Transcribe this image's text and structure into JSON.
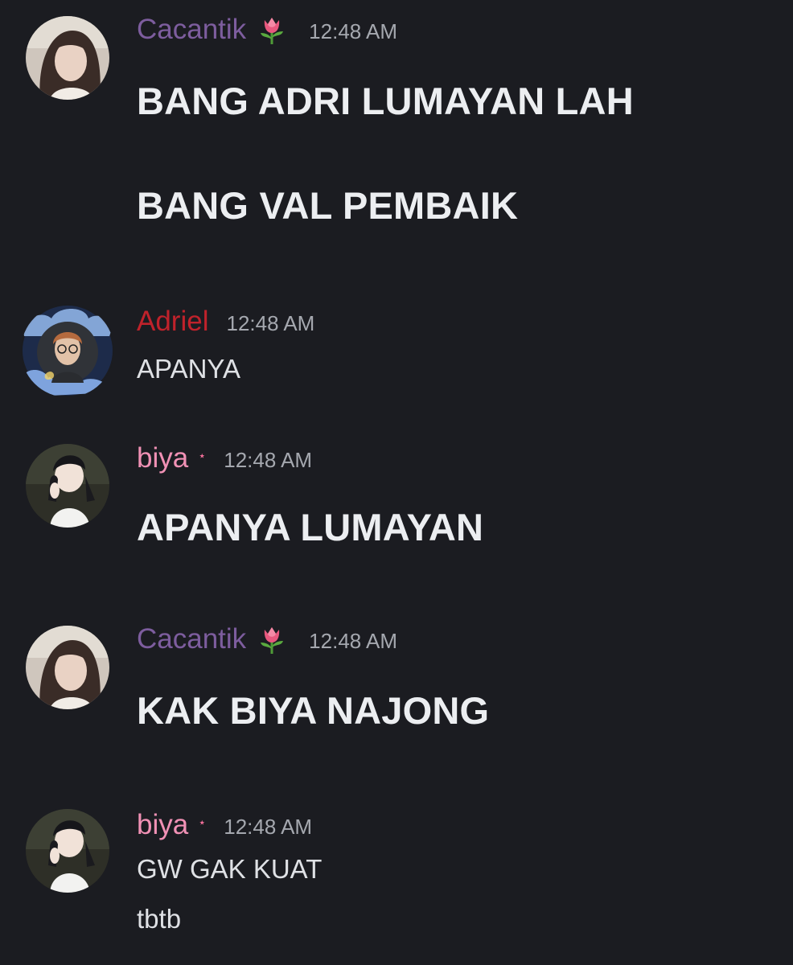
{
  "colors": {
    "background": "#1b1c21",
    "cacantik_name": "#7d5d9e",
    "adriel_name": "#c0222b",
    "biya_name": "#f191b5",
    "timestamp": "#a5a8af",
    "message_text": "#eceef1"
  },
  "messages": [
    {
      "author": "Cacantik",
      "author_icon": "tulip-emoji-icon",
      "time": "12:48 AM",
      "lines": [
        "BANG ADRI LUMAYAN LAH",
        "BANG VAL PEMBAIK"
      ]
    },
    {
      "author": "Adriel",
      "time": "12:48 AM",
      "lines": [
        "APANYA"
      ]
    },
    {
      "author": "biya",
      "author_badge": "⋆",
      "time": "12:48 AM",
      "lines": [
        "APANYA LUMAYAN"
      ]
    },
    {
      "author": "Cacantik",
      "author_icon": "tulip-emoji-icon",
      "time": "12:48 AM",
      "lines": [
        "KAK BIYA NAJONG"
      ]
    },
    {
      "author": "biya",
      "author_badge": "⋆",
      "time": "12:48 AM",
      "lines": [
        "GW GAK KUAT",
        "tbtb"
      ]
    }
  ]
}
